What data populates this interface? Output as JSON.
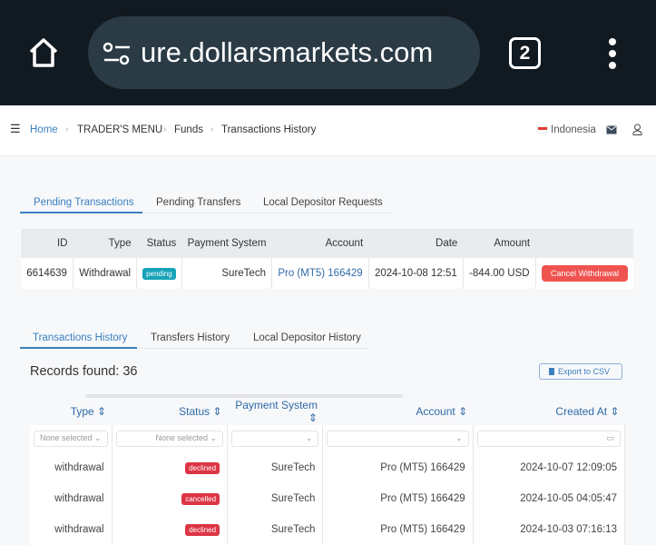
{
  "browser": {
    "url": "ure.dollarsmarkets.com",
    "tab_count": "2"
  },
  "breadcrumb": [
    "Home",
    "TRADER'S MENU",
    "Funds",
    "Transactions History"
  ],
  "header": {
    "language": "Indonesia"
  },
  "pending_tabs": [
    "Pending Transactions",
    "Pending Transfers",
    "Local Depositor Requests"
  ],
  "pending_table": {
    "columns": [
      "ID",
      "Type",
      "Status",
      "Payment System",
      "Account",
      "Date",
      "Amount",
      ""
    ],
    "rows": [
      {
        "id": "6614639",
        "type": "Withdrawal",
        "status": "pending",
        "payment_system": "SureTech",
        "account": "Pro (MT5) 166429",
        "date": "2024-10-08 12:51",
        "amount": "-844.00 USD",
        "action": "Cancel Withdrawal"
      }
    ]
  },
  "history_tabs": [
    "Transactions History",
    "Transfers History",
    "Local Depositor History"
  ],
  "records_found": "Records found: 36",
  "export_label": "Export to CSV",
  "history_table": {
    "columns": [
      "Type",
      "Status",
      "Payment System",
      "Account",
      "Created At"
    ],
    "filters": {
      "type": "None selected",
      "status": "None selected"
    },
    "rows": [
      {
        "type": "withdrawal",
        "status": "declined",
        "payment_system": "SureTech",
        "account": "Pro (MT5) 166429",
        "created_at": "2024-10-07 12:09:05"
      },
      {
        "type": "withdrawal",
        "status": "cancelled",
        "payment_system": "SureTech",
        "account": "Pro (MT5) 166429",
        "created_at": "2024-10-05 04:05:47"
      },
      {
        "type": "withdrawal",
        "status": "declined",
        "payment_system": "SureTech",
        "account": "Pro (MT5) 166429",
        "created_at": "2024-10-03 07:16:13"
      }
    ]
  },
  "colors": {
    "accent": "#3a7fc0",
    "pending": "#17a2b8",
    "declined": "#dc3545",
    "cancel_button": "#ef5350"
  }
}
